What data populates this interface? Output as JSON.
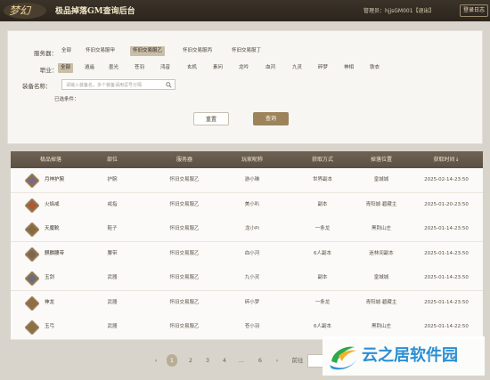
{
  "header": {
    "logo_text": "梦幻",
    "title": "极品掉落GM查询后台",
    "user_text": "管理员：hjjsGM001【退出】",
    "logout_label": "登录日志"
  },
  "filters": {
    "server_label": "服务器：",
    "server_options": [
      "全部",
      "怀旧交易服甲",
      "怀旧交易服乙",
      "怀旧交易服丙",
      "怀旧交易服丁"
    ],
    "class_label": "职业：",
    "class_options": [
      "全部",
      "逍遥",
      "墨光",
      "苍羽",
      "鸿音",
      "玄机",
      "素问",
      "龙吟",
      "血河",
      "九灵",
      "碎梦",
      "神相",
      "铁衣"
    ],
    "item_label": "装备名称：",
    "item_placeholder": "请输入装备名，多个装备请用逗号分隔",
    "selected_label": "已选条件：",
    "reset_label": "重置",
    "query_label": "查询"
  },
  "table": {
    "headers": [
      "极品掉落",
      "部位",
      "服务器",
      "玩家昵称",
      "获取方式",
      "掉落位置",
      "获取时间↓"
    ],
    "rows": [
      {
        "name": "月神护腕",
        "slot": "护腕",
        "server": "怀旧交易服乙",
        "player": "游小琳",
        "method": "世界副本",
        "location": "皇城城",
        "time": "2025-02-14-23:50"
      },
      {
        "name": "火焰戒",
        "slot": "戒指",
        "server": "怀旧交易服乙",
        "player": "美小叭",
        "method": "副本",
        "location": "青阳城·碧藏主",
        "time": "2025-01-20-23:50"
      },
      {
        "name": "天魔靴",
        "slot": "鞋子",
        "server": "怀旧交易服乙",
        "player": "龙小Pi",
        "method": "一条龙",
        "location": "黑荆山庄",
        "time": "2025-01-14-23:50"
      },
      {
        "name": "麒麟腰带",
        "slot": "腰带",
        "server": "怀旧交易服乙",
        "player": "血小河",
        "method": "6人副本",
        "location": "迷林间副本",
        "time": "2025-01-14-23:50"
      },
      {
        "name": "玉剑",
        "slot": "武器",
        "server": "怀旧交易服乙",
        "player": "九小灵",
        "method": "副本",
        "location": "皇城城",
        "time": "2025-01-14-23:50"
      },
      {
        "name": "神龙",
        "slot": "武器",
        "server": "怀旧交易服乙",
        "player": "碎小梦",
        "method": "一条龙",
        "location": "青阳城·碧藏主",
        "time": "2025-01-14-23:50"
      },
      {
        "name": "玉弓",
        "slot": "武器",
        "server": "怀旧交易服乙",
        "player": "苍小羽",
        "method": "6人副本",
        "location": "黑荆山庄",
        "time": "2025-01-14-22:50"
      }
    ]
  },
  "pagination": {
    "prev": "‹",
    "pages": [
      "1",
      "2",
      "3",
      "4",
      "...",
      "6"
    ],
    "next": "›",
    "goto_label": "前往"
  },
  "watermark": {
    "text": "云之居软件园"
  },
  "colors": {
    "topbar": "#2f2920",
    "accent": "#9c835a",
    "header_row": "#5f5547",
    "selected_option": "#c9bea8"
  }
}
